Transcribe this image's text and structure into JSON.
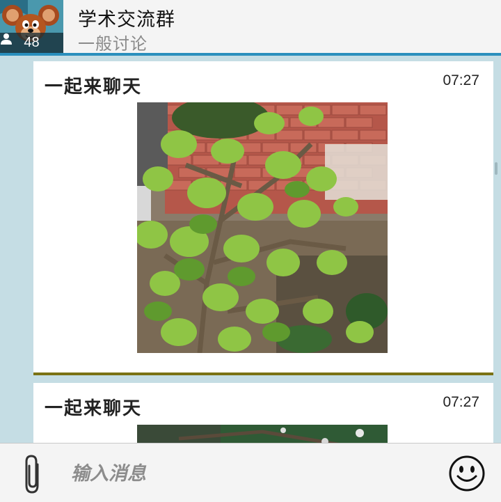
{
  "header": {
    "title": "学术交流群",
    "subtitle": "一般讨论",
    "member_count": "48",
    "avatar_icon": "cartoon-mouse-avatar",
    "accent_color": "#2a8fbd"
  },
  "messages": [
    {
      "sender": "一起来聊天",
      "time": "07:27",
      "image": "green-shrub-photo"
    },
    {
      "sender": "一起来聊天",
      "time": "07:27",
      "image": "tree-photo"
    }
  ],
  "composer": {
    "placeholder": "输入消息",
    "attach_icon": "paperclip-icon",
    "emoji_icon": "smiley-icon"
  }
}
